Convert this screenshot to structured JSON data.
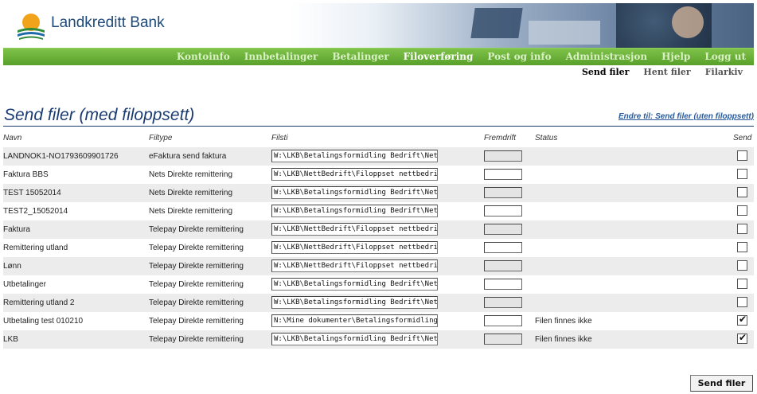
{
  "brand": {
    "name": "Landkreditt Bank"
  },
  "nav": [
    "Kontoinfo",
    "Innbetalinger",
    "Betalinger",
    "Filoverføring",
    "Post og info",
    "Administrasjon",
    "Hjelp",
    "Logg ut"
  ],
  "nav_active": "Filoverføring",
  "subnav": [
    "Send filer",
    "Hent filer",
    "Filarkiv"
  ],
  "subnav_active": "Send filer",
  "page": {
    "title": "Send filer (med filoppsett)",
    "switch_link": "Endre til: Send filer (uten filoppsett)"
  },
  "table": {
    "headers": {
      "name": "Navn",
      "type": "Filtype",
      "path": "Filsti",
      "progress": "Fremdrift",
      "status": "Status",
      "send": "Send"
    },
    "rows": [
      {
        "name": "LANDNOK1-NO1793609901726",
        "type": "eFaktura send faktura",
        "path": "W:\\LKB\\Betalingsformidling Bedrift\\Nettbank",
        "status": "",
        "send": false,
        "progress_shown": true
      },
      {
        "name": "Faktura BBS",
        "type": "Nets Direkte remittering",
        "path": "W:\\LKB\\NettBedrift\\Filoppset nettbedrift\\test",
        "status": "",
        "send": false,
        "progress_shown": false
      },
      {
        "name": "TEST 15052014",
        "type": "Nets Direkte remittering",
        "path": "W:\\LKB\\Betalingsformidling Bedrift\\Nettbank",
        "status": "",
        "send": false,
        "progress_shown": true
      },
      {
        "name": "TEST2_15052014",
        "type": "Nets Direkte remittering",
        "path": "W:\\LKB\\Betalingsformidling Bedrift\\Nettbank",
        "status": "",
        "send": false,
        "progress_shown": false
      },
      {
        "name": "Faktura",
        "type": "Telepay Direkte remittering",
        "path": "W:\\LKB\\NettBedrift\\Filoppset nettbedrift\\test",
        "status": "",
        "send": false,
        "progress_shown": true
      },
      {
        "name": "Remittering utland",
        "type": "Telepay Direkte remittering",
        "path": "W:\\LKB\\NettBedrift\\Filoppset nettbedrift\\utl",
        "status": "",
        "send": false,
        "progress_shown": false
      },
      {
        "name": "Lønn",
        "type": "Telepay Direkte remittering",
        "path": "W:\\LKB\\NettBedrift\\Filoppset nettbedrift\\ktl",
        "status": "",
        "send": false,
        "progress_shown": true
      },
      {
        "name": "Utbetalinger",
        "type": "Telepay Direkte remittering",
        "path": "W:\\LKB\\Betalingsformidling Bedrift\\Nettbank",
        "status": "",
        "send": false,
        "progress_shown": false
      },
      {
        "name": "Remittering utland 2",
        "type": "Telepay Direkte remittering",
        "path": "W:\\LKB\\Betalingsformidling Bedrift\\Nettbank",
        "status": "",
        "send": false,
        "progress_shown": true
      },
      {
        "name": "Utbetaling test 010210",
        "type": "Telepay Direkte remittering",
        "path": "N:\\Mine dokumenter\\Betalingsformidling Bedrift",
        "status": "Filen finnes ikke",
        "send": true,
        "progress_shown": false
      },
      {
        "name": "LKB",
        "type": "Telepay Direkte remittering",
        "path": "W:\\LKB\\Betalingsformidling Bedrift\\Nettbank",
        "status": "Filen finnes ikke",
        "send": true,
        "progress_shown": true
      }
    ]
  },
  "send_button": "Send filer",
  "colors": {
    "nav_green": "#58a02a",
    "title_blue": "#1b3b73",
    "row_shade": "#ececec"
  },
  "icons": {
    "logo": "landkreditt-logo-icon",
    "checkbox": "checkmark-icon"
  }
}
